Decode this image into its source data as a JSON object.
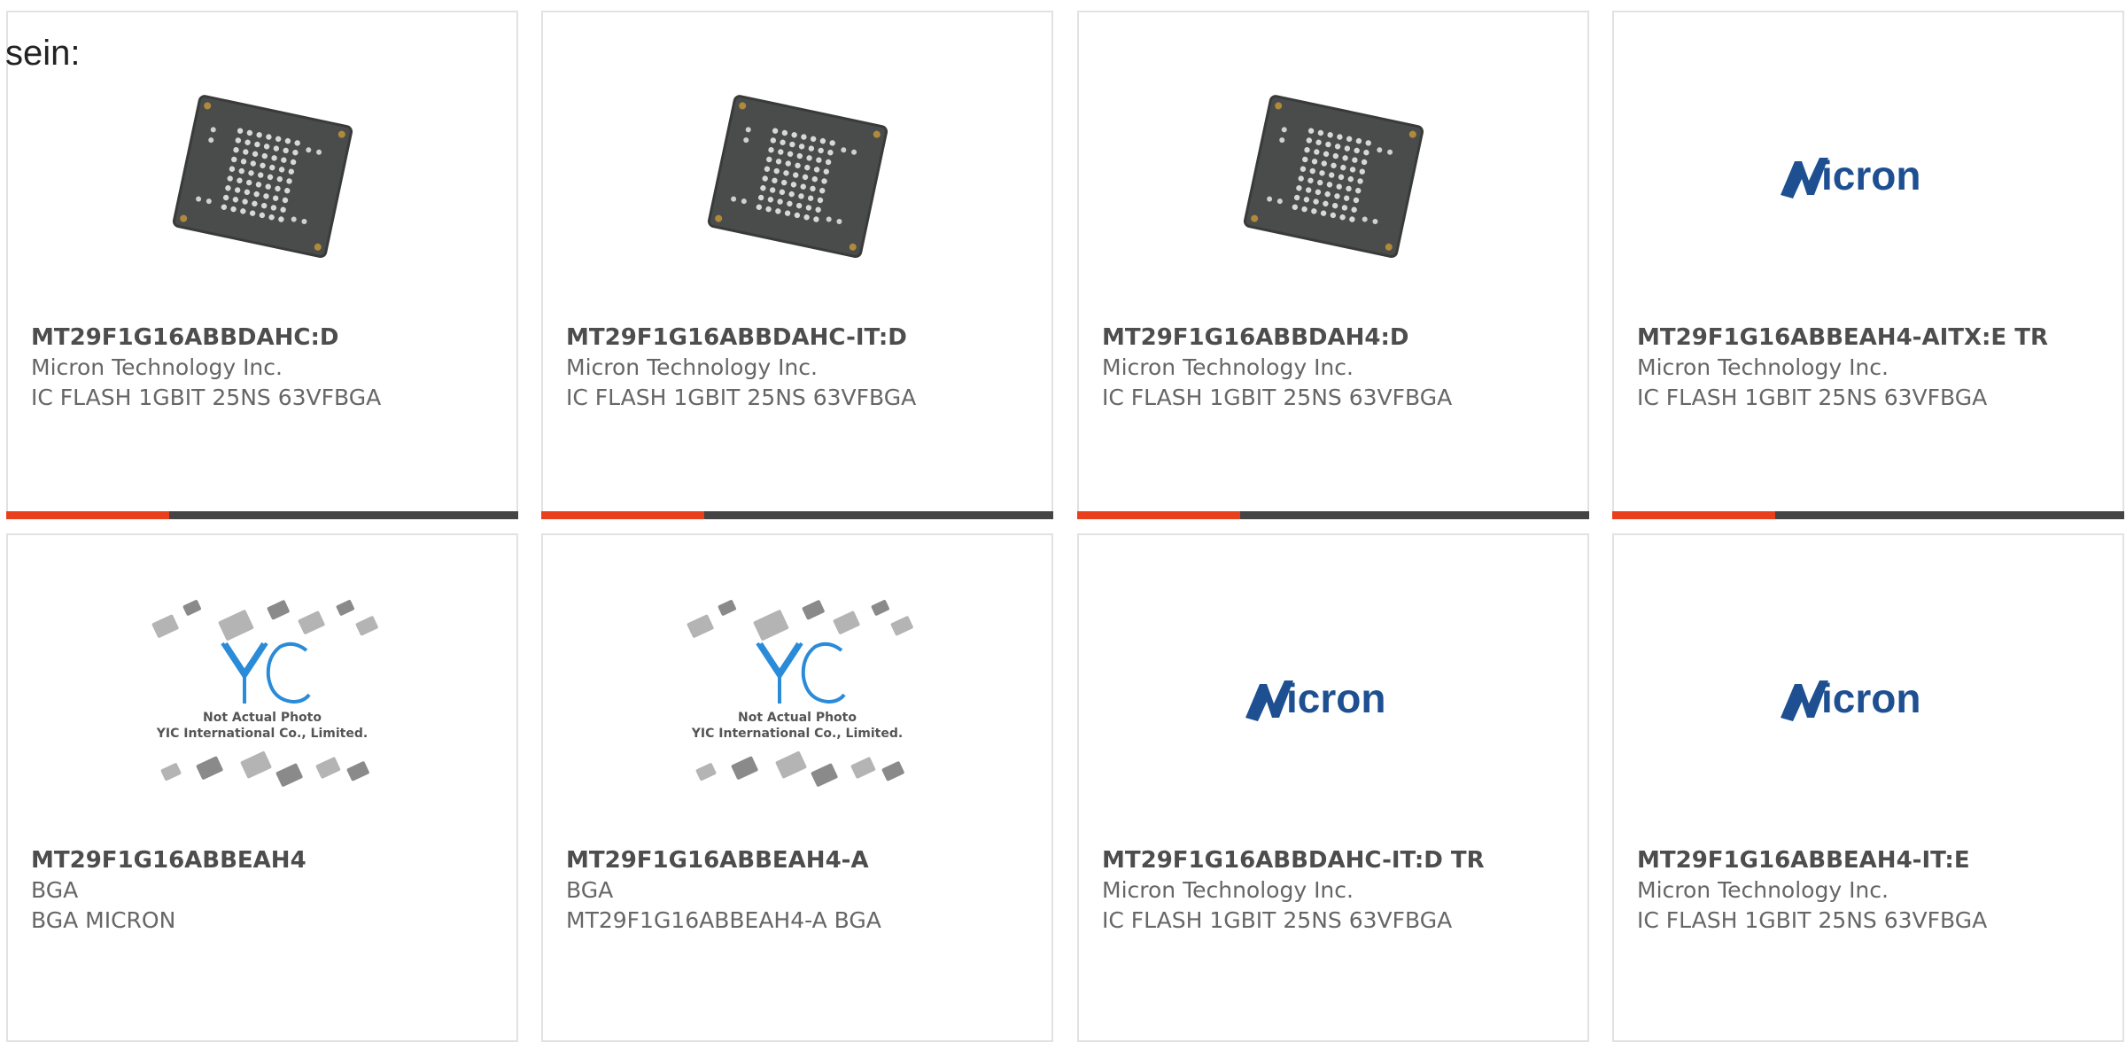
{
  "intro_text": "sein:",
  "products": [
    {
      "part": "MT29F1G16ABBDAHC:D",
      "manufacturer": "Micron Technology Inc.",
      "description": "IC FLASH 1GBIT 25NS 63VFBGA",
      "image": "chip-photo",
      "highlight": true
    },
    {
      "part": "MT29F1G16ABBDAHC-IT:D",
      "manufacturer": "Micron Technology Inc.",
      "description": "IC FLASH 1GBIT 25NS 63VFBGA",
      "image": "chip-photo",
      "highlight": true
    },
    {
      "part": "MT29F1G16ABBDAH4:D",
      "manufacturer": "Micron Technology Inc.",
      "description": "IC FLASH 1GBIT 25NS 63VFBGA",
      "image": "chip-photo",
      "highlight": true
    },
    {
      "part": "MT29F1G16ABBEAH4-AITX:E TR",
      "manufacturer": "Micron Technology Inc.",
      "description": "IC FLASH 1GBIT 25NS 63VFBGA",
      "image": "micron-logo",
      "highlight": true
    },
    {
      "part": "MT29F1G16ABBEAH4",
      "manufacturer": "BGA",
      "description": "BGA MICRON",
      "image": "yic-placeholder",
      "highlight": false
    },
    {
      "part": "MT29F1G16ABBEAH4-A",
      "manufacturer": "BGA",
      "description": "MT29F1G16ABBEAH4-A BGA",
      "image": "yic-placeholder",
      "highlight": false
    },
    {
      "part": "MT29F1G16ABBDAHC-IT:D TR",
      "manufacturer": "Micron Technology Inc.",
      "description": "IC FLASH 1GBIT 25NS 63VFBGA",
      "image": "micron-logo",
      "highlight": false
    },
    {
      "part": "MT29F1G16ABBEAH4-IT:E",
      "manufacturer": "Micron Technology Inc.",
      "description": "IC FLASH 1GBIT 25NS 63VFBGA",
      "image": "micron-logo",
      "highlight": false
    }
  ],
  "logo_text": {
    "micron": "Micron"
  },
  "placeholder_text": {
    "line1": "Not Actual Photo",
    "line2": "YIC International Co., Limited."
  },
  "colors": {
    "accent": "#e8401c",
    "bar": "#444444",
    "micron_blue": "#1d4f91",
    "yic_blue": "#2a8bd8"
  }
}
